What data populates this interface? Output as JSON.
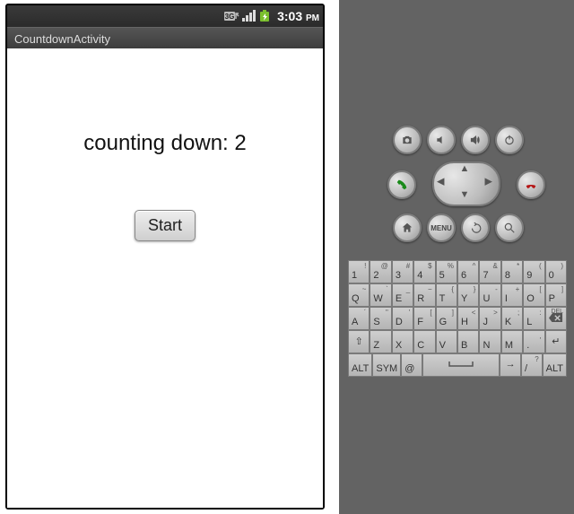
{
  "statusbar": {
    "threeG": "3G",
    "time": "3:03",
    "ampm": "PM"
  },
  "titlebar": {
    "title": "CountdownActivity"
  },
  "app": {
    "countText": "counting down: 2",
    "startLabel": "Start"
  },
  "hwIcons": {
    "camera": "camera-icon",
    "volDown": "volume-down-icon",
    "volUp": "volume-up-icon",
    "power": "power-icon",
    "call": "call-icon",
    "end": "end-call-icon",
    "home": "home-icon",
    "menu": "MENU",
    "back": "back-icon",
    "search": "search-icon"
  },
  "keyboard": {
    "row1": [
      {
        "m": "1",
        "s": "!"
      },
      {
        "m": "2",
        "s": "@"
      },
      {
        "m": "3",
        "s": "#"
      },
      {
        "m": "4",
        "s": "$"
      },
      {
        "m": "5",
        "s": "%"
      },
      {
        "m": "6",
        "s": "^"
      },
      {
        "m": "7",
        "s": "&"
      },
      {
        "m": "8",
        "s": "*"
      },
      {
        "m": "9",
        "s": "("
      },
      {
        "m": "0",
        "s": ")"
      }
    ],
    "row2": [
      {
        "m": "Q",
        "s": "~"
      },
      {
        "m": "W",
        "s": "`"
      },
      {
        "m": "E",
        "s": "_"
      },
      {
        "m": "R",
        "s": "−"
      },
      {
        "m": "T",
        "s": "{"
      },
      {
        "m": "Y",
        "s": "}"
      },
      {
        "m": "U",
        "s": "‑"
      },
      {
        "m": "I",
        "s": "+"
      },
      {
        "m": "O",
        "s": "["
      },
      {
        "m": "P",
        "s": "]"
      }
    ],
    "row3": [
      {
        "m": "A",
        "s": "´"
      },
      {
        "m": "S",
        "s": "\""
      },
      {
        "m": "D",
        "s": "'"
      },
      {
        "m": "F",
        "s": "["
      },
      {
        "m": "G",
        "s": "]"
      },
      {
        "m": "H",
        "s": "<"
      },
      {
        "m": "J",
        "s": ">"
      },
      {
        "m": "K",
        "s": ";"
      },
      {
        "m": "L",
        "s": ":"
      },
      {
        "m": "DEL",
        "s": "",
        "del": true
      }
    ],
    "row4": [
      {
        "m": "⇧",
        "s": "",
        "wide": "1"
      },
      {
        "m": "Z",
        "s": ""
      },
      {
        "m": "X",
        "s": ""
      },
      {
        "m": "C",
        "s": ""
      },
      {
        "m": "V",
        "s": ""
      },
      {
        "m": "B",
        "s": ""
      },
      {
        "m": "N",
        "s": ""
      },
      {
        "m": "M",
        "s": ""
      },
      {
        "m": ".",
        "s": ","
      },
      {
        "m": "↵",
        "s": "",
        "wide": "1"
      }
    ],
    "row5": [
      {
        "m": "ALT",
        "wide": "1"
      },
      {
        "m": "SYM",
        "wide": "1"
      },
      {
        "m": "@",
        "wide": "1"
      },
      {
        "m": "",
        "space": true,
        "wide": "5"
      },
      {
        "m": "→",
        "wide": "1"
      },
      {
        "m": "/",
        "s": "?",
        "wide": "1"
      },
      {
        "m": "ALT",
        "wide": "1"
      }
    ]
  }
}
